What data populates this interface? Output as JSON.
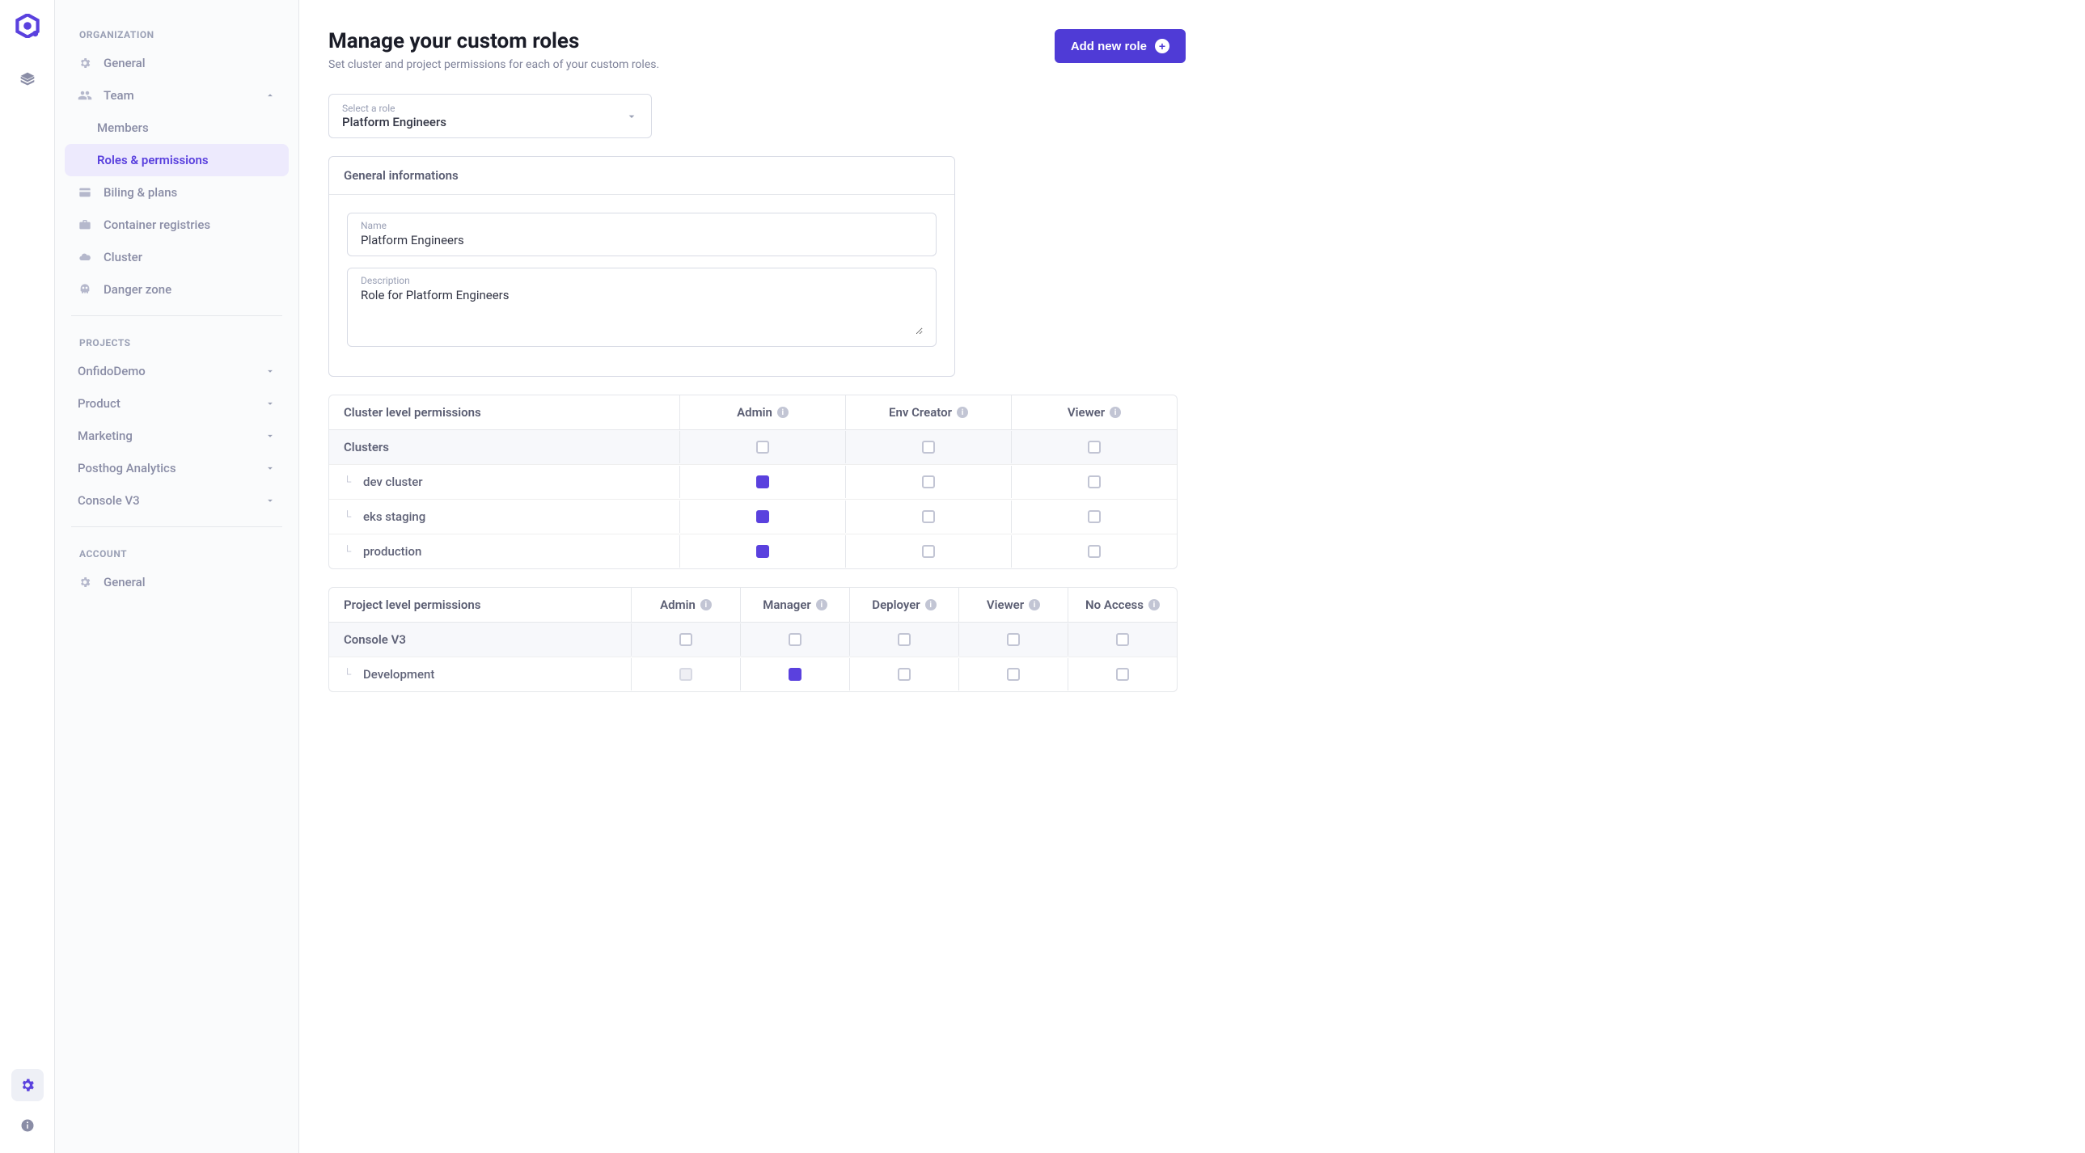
{
  "rail": {
    "logo_color": "#5a41de"
  },
  "sidebar": {
    "org_label": "ORGANIZATION",
    "items": {
      "general": "General",
      "team": "Team",
      "members": "Members",
      "roles": "Roles & permissions",
      "billing": "Biling & plans",
      "container_reg": "Container registries",
      "cluster": "Cluster",
      "danger": "Danger zone"
    },
    "projects_label": "PROJECTS",
    "projects": [
      "OnfidoDemo",
      "Product",
      "Marketing",
      "Posthog Analytics",
      "Console V3"
    ],
    "account_label": "ACCOUNT",
    "account_items": {
      "general": "General"
    }
  },
  "page": {
    "title": "Manage your custom roles",
    "subtitle": "Set cluster and project permissions for each of your custom roles.",
    "add_button": "Add new role"
  },
  "role_select": {
    "label": "Select a role",
    "value": "Platform Engineers"
  },
  "general_info": {
    "card_title": "General informations",
    "name_label": "Name",
    "name_value": "Platform Engineers",
    "desc_label": "Description",
    "desc_value": "Role for Platform Engineers"
  },
  "cluster_perms": {
    "title": "Cluster level permissions",
    "columns": [
      "Admin",
      "Env Creator",
      "Viewer"
    ],
    "group": "Clusters",
    "group_checks": [
      false,
      false,
      false
    ],
    "rows": [
      {
        "name": "dev cluster",
        "checks": [
          true,
          false,
          false
        ]
      },
      {
        "name": "eks staging",
        "checks": [
          true,
          false,
          false
        ]
      },
      {
        "name": "production",
        "checks": [
          true,
          false,
          false
        ]
      }
    ]
  },
  "project_perms": {
    "title": "Project level permissions",
    "columns": [
      "Admin",
      "Manager",
      "Deployer",
      "Viewer",
      "No Access"
    ],
    "group": "Console V3",
    "group_checks": [
      false,
      false,
      false,
      false,
      false
    ],
    "rows": [
      {
        "name": "Development",
        "checks": [
          "disabled",
          true,
          false,
          false,
          false
        ]
      }
    ]
  }
}
